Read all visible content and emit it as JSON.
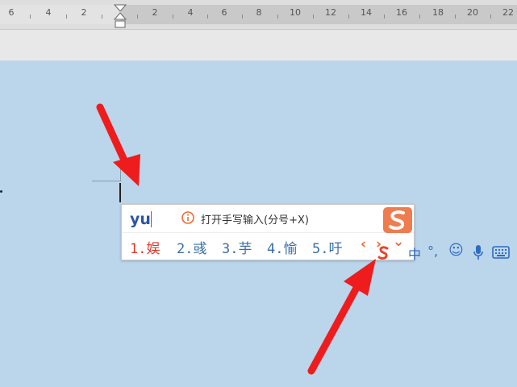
{
  "ruler": {
    "ticks": [
      "6",
      "4",
      "2",
      "2",
      "4",
      "6",
      "8",
      "10",
      "12",
      "14",
      "16",
      "18",
      "20",
      "22"
    ]
  },
  "ime": {
    "pinyin": "yu",
    "hint": "打开手写输入(分号+X)",
    "candidates": [
      "1.娱",
      "2.彧",
      "3.芋",
      "4.愉",
      "5.吁"
    ],
    "prev_glyph": "‹",
    "next_glyph": "›",
    "expand_glyph": "⌄"
  },
  "toolbar": {
    "items": [
      "中",
      "°,",
      "☺",
      "🎤",
      "⌨"
    ]
  },
  "colors": {
    "page": "#bbd5eb",
    "accent": "#e8452c",
    "candidate": "#3a6fa8",
    "first_candidate": "#e03a2b",
    "arrow": "#ee1c1c"
  },
  "icons": [
    "info-icon",
    "sogou-logo-icon",
    "prev-page-icon",
    "next-page-icon",
    "expand-icon",
    "microphone-icon",
    "keyboard-icon",
    "emoji-icon"
  ]
}
